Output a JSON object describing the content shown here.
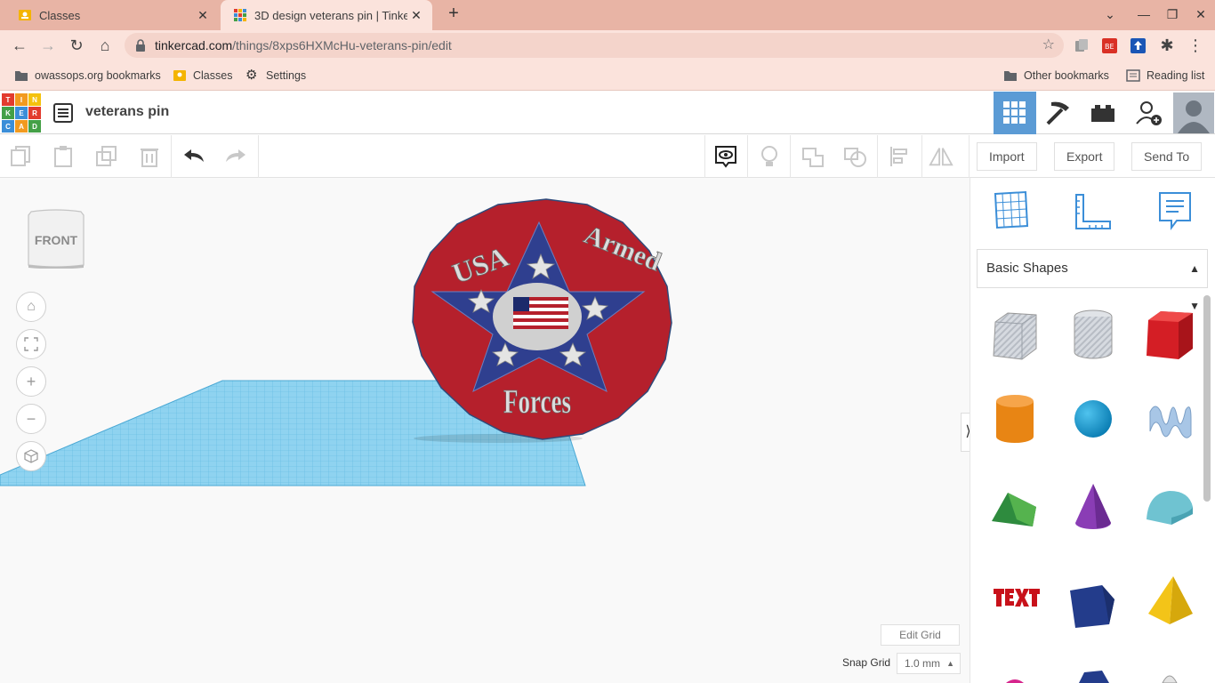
{
  "browser": {
    "tabs": [
      {
        "title": "Classes",
        "active": false
      },
      {
        "title": "3D design veterans pin | Tinkerca",
        "active": true
      }
    ],
    "url_host": "tinkercad.com",
    "url_path": "/things/8xps6HXMcHu-veterans-pin/edit",
    "bookmarks": [
      {
        "label": "owassops.org bookmarks"
      },
      {
        "label": "Classes"
      },
      {
        "label": "Settings"
      }
    ],
    "bookmarks_right": [
      {
        "label": "Other bookmarks"
      },
      {
        "label": "Reading list"
      }
    ]
  },
  "tinkercad": {
    "logo_letters": [
      "T",
      "I",
      "N",
      "K",
      "E",
      "R",
      "C",
      "A",
      "D"
    ],
    "design_name": "veterans pin",
    "toolbar": {
      "import_label": "Import",
      "export_label": "Export",
      "sendto_label": "Send To"
    },
    "viewcube_label": "FRONT",
    "edit_grid_label": "Edit Grid",
    "snap_grid_label": "Snap Grid",
    "snap_grid_value": "1.0 mm",
    "shape_category": "Basic Shapes",
    "pin": {
      "text_top_left": "USA",
      "text_top_right": "Armed",
      "text_bottom": "Forces"
    },
    "colors": {
      "accent": "#5b9bd5",
      "pin_red": "#b5202c",
      "pin_blue": "#2f3f8f",
      "grid_blue": "#8fd3f0"
    }
  }
}
